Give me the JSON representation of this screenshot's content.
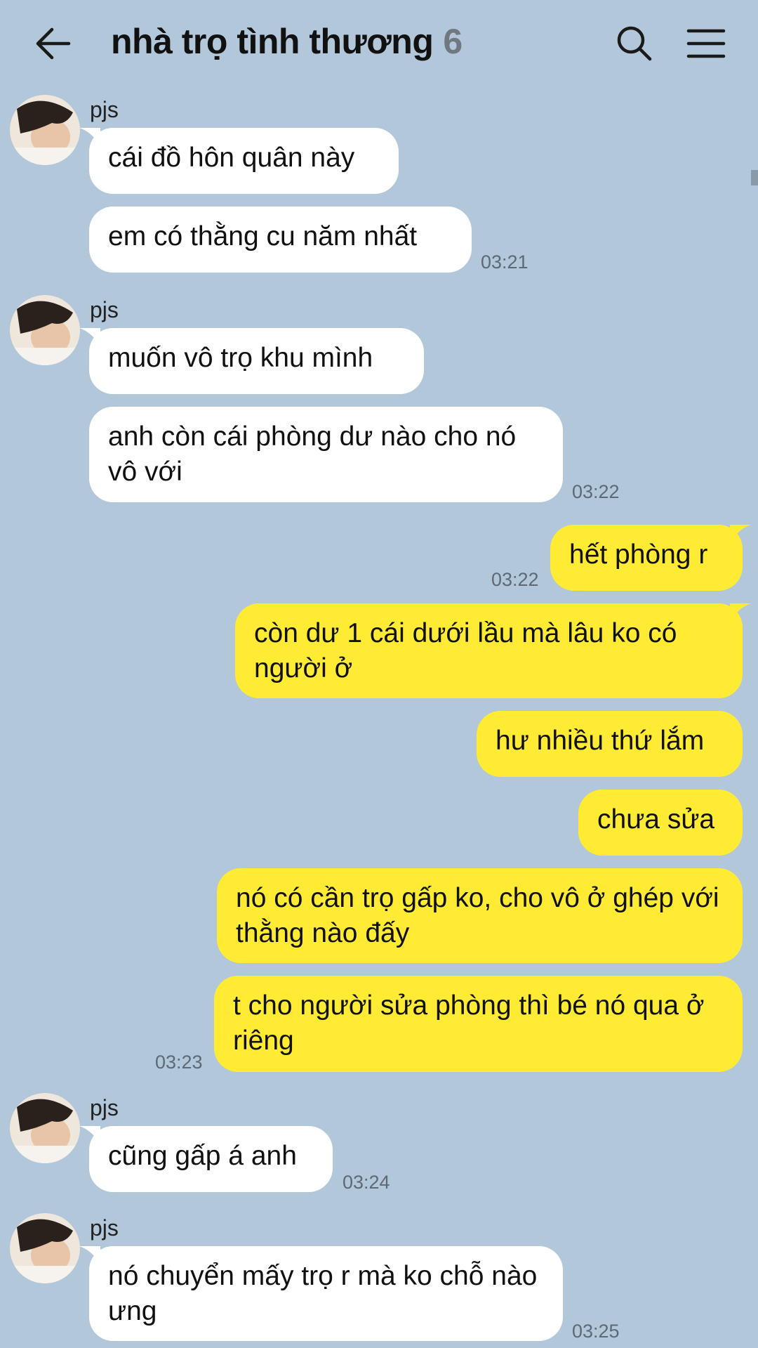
{
  "header": {
    "title": "nhà trọ tình thương",
    "member_count": "6",
    "back_icon": "arrow-left-icon",
    "search_icon": "search-icon",
    "menu_icon": "hamburger-menu-icon"
  },
  "colors": {
    "background": "#b2c7da",
    "incoming_bubble": "#ffffff",
    "outgoing_bubble": "#ffeb33",
    "timestamp": "#5d6a76"
  },
  "groups": [
    {
      "sender": "pjs",
      "messages": [
        "cái đồ hôn quân này",
        "em có thằng cu năm nhất"
      ],
      "time": "03:21"
    },
    {
      "sender": "pjs",
      "messages": [
        "muốn vô trọ khu mình",
        "anh còn cái phòng dư nào cho nó vô với"
      ],
      "time": "03:22"
    },
    {
      "sender": "me",
      "messages": [
        "hết phòng r"
      ],
      "time": "03:22"
    },
    {
      "sender": "me",
      "messages": [
        "còn dư 1 cái dưới lầu mà lâu ko có người ở",
        "hư nhiều thứ lắm",
        "chưa sửa",
        "nó có cần trọ gấp ko, cho vô ở ghép với thằng nào đấy",
        "t cho người sửa phòng thì bé nó qua ở riêng"
      ],
      "time": "03:23"
    },
    {
      "sender": "pjs",
      "messages": [
        "cũng gấp á anh"
      ],
      "time": "03:24"
    },
    {
      "sender": "pjs",
      "messages": [
        "nó chuyển mấy trọ r mà ko chỗ nào ưng"
      ],
      "time": "03:25"
    }
  ]
}
